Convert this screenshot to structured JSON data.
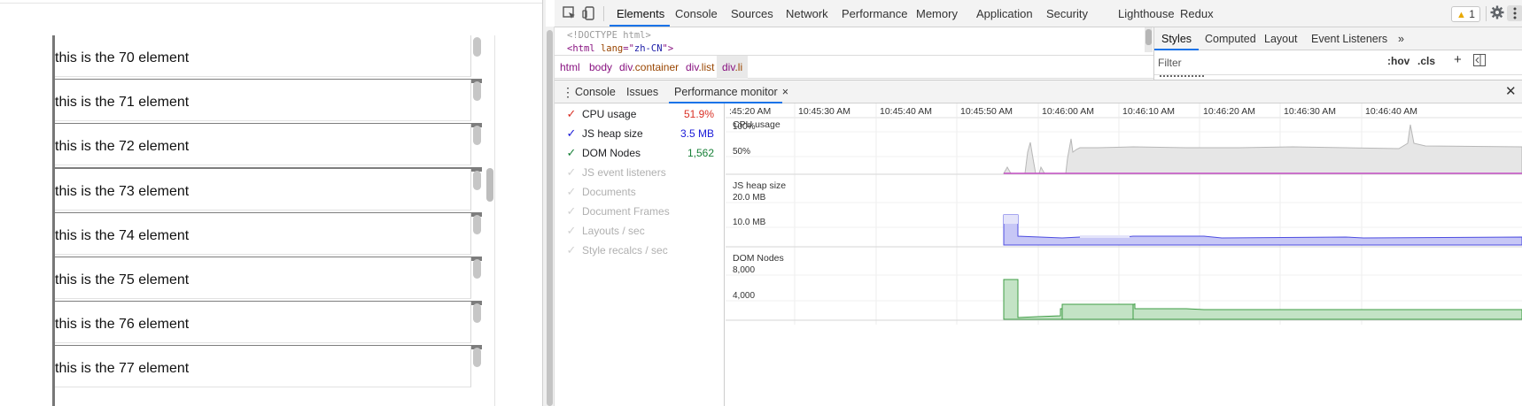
{
  "page": {
    "items": [
      "this is the 70 element",
      "this is the 71 element",
      "this is the 72 element",
      "this is the 73 element",
      "this is the 74 element",
      "this is the 75 element",
      "this is the 76 element",
      "this is the 77 element"
    ]
  },
  "devtools": {
    "toolbar": {
      "inspect_icon": "cursor-select-icon",
      "device_icon": "device-toggle-icon",
      "tabs": [
        "Elements",
        "Console",
        "Sources",
        "Network",
        "Performance",
        "Memory",
        "Application",
        "Security",
        "Lighthouse",
        "Redux"
      ],
      "active_tab": "Elements",
      "warning_count": "1",
      "settings_icon": "gear-icon",
      "menu_icon": "kebab-menu-icon",
      "close_icon": "close-icon"
    },
    "elements": {
      "doctype": "<!DOCTYPE html>",
      "html_tag": "html",
      "html_attr_name": "lang",
      "html_attr_value": "zh-CN",
      "breadcrumbs": [
        {
          "tag": "html",
          "cls": ""
        },
        {
          "tag": "body",
          "cls": ""
        },
        {
          "tag": "div",
          "cls": ".container"
        },
        {
          "tag": "div",
          "cls": ".list"
        },
        {
          "tag": "div",
          "cls": ".li"
        }
      ]
    },
    "styles": {
      "tabs": [
        "Styles",
        "Computed",
        "Layout",
        "Event Listeners"
      ],
      "active_tab": "Styles",
      "more_icon": "double-chevron-right-icon",
      "filter_placeholder": "Filter",
      "hov_label": ":hov",
      "cls_label": ".cls",
      "add_rule_label": "+",
      "sidebar_toggle_icon": "sidebar-toggle-icon"
    },
    "drawer": {
      "menu_icon": "kebab-menu-icon",
      "tabs": [
        "Console",
        "Issues",
        "Performance monitor"
      ],
      "active_tab": "Performance monitor",
      "tab_close": "×",
      "close_icon": "close-icon"
    },
    "perf_monitor": {
      "metrics": [
        {
          "label": "CPU usage",
          "value": "51.9%",
          "checked": true,
          "color": "#d93025"
        },
        {
          "label": "JS heap size",
          "value": "3.5 MB",
          "checked": true,
          "color": "#1a1ad8"
        },
        {
          "label": "DOM Nodes",
          "value": "1,562",
          "checked": true,
          "color": "#188038"
        },
        {
          "label": "JS event listeners",
          "value": "",
          "checked": false,
          "color": "#c8c8c8"
        },
        {
          "label": "Documents",
          "value": "",
          "checked": false,
          "color": "#c8c8c8"
        },
        {
          "label": "Document Frames",
          "value": "",
          "checked": false,
          "color": "#c8c8c8"
        },
        {
          "label": "Layouts / sec",
          "value": "",
          "checked": false,
          "color": "#c8c8c8"
        },
        {
          "label": "Style recalcs / sec",
          "value": "",
          "checked": false,
          "color": "#c8c8c8"
        }
      ],
      "time_ticks": [
        ":45:20 AM",
        "10:45:30 AM",
        "10:45:40 AM",
        "10:45:50 AM",
        "10:46:00 AM",
        "10:46:10 AM",
        "10:46:20 AM",
        "10:46:30 AM",
        "10:46:40 AM"
      ],
      "charts": [
        {
          "title": "CPU usage",
          "axis_labels": [
            "100%",
            "50%"
          ]
        },
        {
          "title": "JS heap size",
          "axis_labels": [
            "20.0 MB",
            "10.0 MB"
          ]
        },
        {
          "title": "DOM Nodes",
          "axis_labels": [
            "8,000",
            "4,000"
          ]
        }
      ]
    }
  }
}
